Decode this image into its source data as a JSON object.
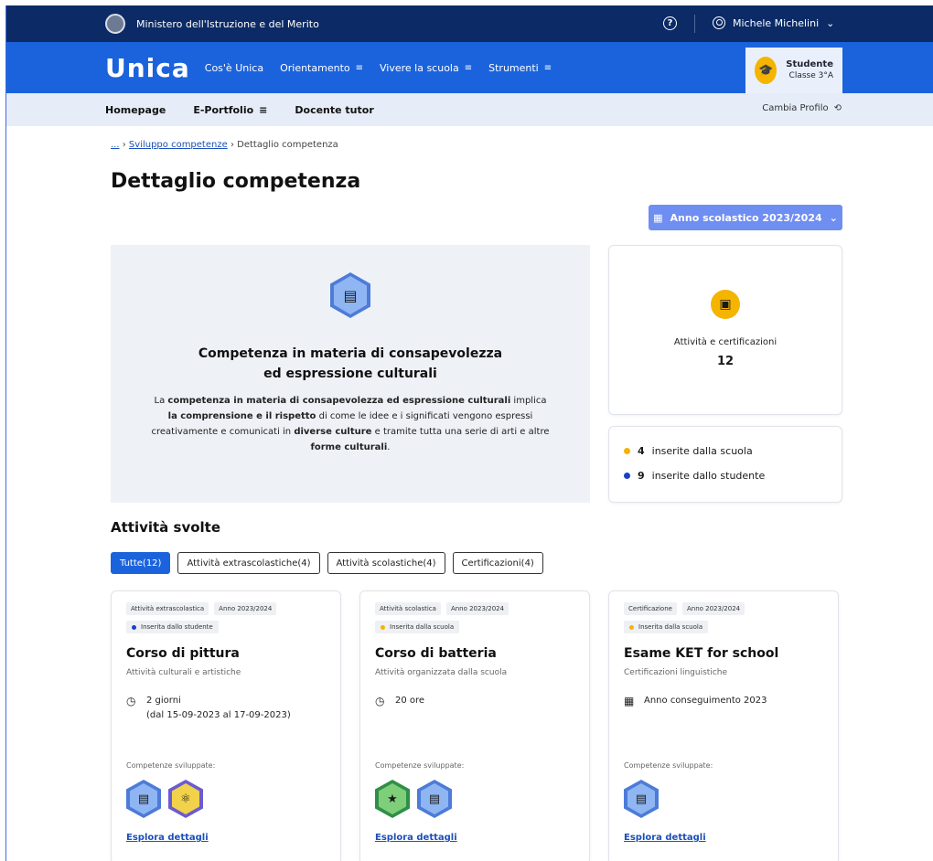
{
  "topbar": {
    "ministry": "Ministero dell'Istruzione e del Merito",
    "user_name": "Michele Michelini",
    "help_label": "?"
  },
  "mainnav": {
    "logo": "Unica",
    "items": [
      {
        "label": "Cos'è Unica",
        "menu": false
      },
      {
        "label": "Orientamento",
        "menu": true
      },
      {
        "label": "Vivere la scuola",
        "menu": true
      },
      {
        "label": "Strumenti",
        "menu": true
      }
    ],
    "profile": {
      "role": "Studente",
      "class": "Classe 3°A"
    }
  },
  "subnav": {
    "items": [
      {
        "label": "Homepage",
        "menu": false
      },
      {
        "label": "E-Portfolio",
        "menu": true
      },
      {
        "label": "Docente tutor",
        "menu": false
      }
    ],
    "change_profile": "Cambia Profilo"
  },
  "breadcrumb": {
    "root": "...",
    "link": "Sviluppo competenze",
    "current": "Dettaglio competenza"
  },
  "page_title": "Dettaglio competenza",
  "year_selector": "Anno scolastico 2023/2024",
  "hero": {
    "title_line1": "Competenza in materia di consapevolezza",
    "title_line2": "ed espressione culturali",
    "desc": [
      {
        "t": "La ",
        "b": false
      },
      {
        "t": "competenza in materia di consapevolezza ed espressione culturali",
        "b": true
      },
      {
        "t": " implica ",
        "b": false
      },
      {
        "t": "la comprensione e il rispetto",
        "b": true
      },
      {
        "t": " di come le idee e i significati vengono espressi creativamente e comunicati in ",
        "b": false
      },
      {
        "t": "diverse culture",
        "b": true
      },
      {
        "t": " e tramite tutta una serie di arti e altre ",
        "b": false
      },
      {
        "t": "forme culturali",
        "b": true
      },
      {
        "t": ".",
        "b": false
      }
    ]
  },
  "summary": {
    "label": "Attività e certificazioni",
    "count": "12",
    "school_count": "4",
    "school_text": "inserite dalla scuola",
    "student_count": "9",
    "student_text": "inserite dallo studente"
  },
  "colors": {
    "school": "#f5b400",
    "student": "#1b3fc7",
    "primary": "#1b63dc"
  },
  "activities_title": "Attività svolte",
  "filters": [
    "Tutte(12)",
    "Attività extrascolastiche(4)",
    "Attività scolastiche(4)",
    "Certificazioni(4)"
  ],
  "cards": [
    {
      "type": "Attività extrascolastica",
      "year": "Anno 2023/2024",
      "source": "Inserita dallo studente",
      "source_color": "#1b3fc7",
      "title": "Corso di pittura",
      "subtitle": "Attività culturali e artistiche",
      "meta_icon": "clock-icon",
      "meta_line1": "2 giorni",
      "meta_line2": "(dal 15-09-2023 al 17-09-2023)",
      "dev_label": "Competenze sviluppate:",
      "badges": [
        {
          "name": "culture-badge-icon",
          "outer": "#4d7bd8",
          "inner": "#8fb6f3",
          "glyph": "▤"
        },
        {
          "name": "science-badge-icon",
          "outer": "#6b5bd0",
          "inner": "#f1d24a",
          "glyph": "⚛"
        }
      ],
      "link": "Esplora dettagli"
    },
    {
      "type": "Attività scolastica",
      "year": "Anno 2023/2024",
      "source": "Inserita dalla scuola",
      "source_color": "#f5b400",
      "title": "Corso di batteria",
      "subtitle": "Attività organizzata dalla scuola",
      "meta_icon": "clock-icon",
      "meta_line1": "20 ore",
      "meta_line2": "",
      "dev_label": "Competenze sviluppate:",
      "badges": [
        {
          "name": "citizenship-badge-icon",
          "outer": "#2f8f46",
          "inner": "#7fcf7a",
          "glyph": "★"
        },
        {
          "name": "culture-badge-icon",
          "outer": "#4d7bd8",
          "inner": "#8fb6f3",
          "glyph": "▤"
        }
      ],
      "link": "Esplora dettagli"
    },
    {
      "type": "Certificazione",
      "year": "Anno 2023/2024",
      "source": "Inserita dalla scuola",
      "source_color": "#f5b400",
      "title": "Esame KET for school",
      "subtitle": "Certificazioni linguistiche",
      "meta_icon": "calendar-icon",
      "meta_line1": "Anno conseguimento 2023",
      "meta_line2": "",
      "dev_label": "Competenze sviluppate:",
      "badges": [
        {
          "name": "culture-badge-icon",
          "outer": "#4d7bd8",
          "inner": "#8fb6f3",
          "glyph": "▤"
        }
      ],
      "link": "Esplora dettagli"
    }
  ]
}
